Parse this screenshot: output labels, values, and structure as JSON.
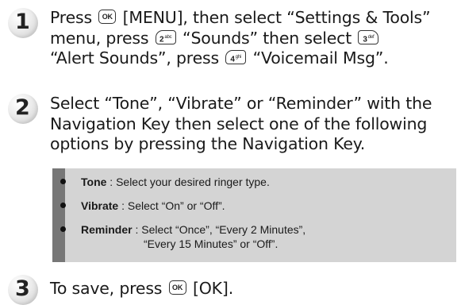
{
  "step1": {
    "number": "1",
    "line1_a": "Press",
    "ok_key": "OK",
    "line1_b": "[MENU], then select “Settings & Tools”",
    "line2_a": "menu, press",
    "key2": "2",
    "key2_letters": "abc",
    "line2_b": "“Sounds” then select",
    "key3": "3",
    "key3_letters": "def",
    "line3_a": "“Alert Sounds”, press",
    "key4": "4",
    "key4_letters": "ghi",
    "line3_b": "“Voicemail Msg”."
  },
  "step2": {
    "number": "2",
    "line1": "Select “Tone”, “Vibrate” or “Reminder” with the",
    "line2": "Navigation Key then select one of the following",
    "line3": "options by pressing the Navigation Key."
  },
  "options": [
    {
      "term": "Tone",
      "desc": ": Select your desired ringer type."
    },
    {
      "term": "Vibrate",
      "desc": ": Select “On” or “Off”."
    },
    {
      "term": "Reminder",
      "desc": ": Select “Once”, “Every 2 Minutes”,",
      "desc2": "“Every 15 Minutes” or “Off”."
    }
  ],
  "step3": {
    "number": "3",
    "text_a": "To save, press",
    "ok_key": "OK",
    "text_b": "[OK]."
  }
}
